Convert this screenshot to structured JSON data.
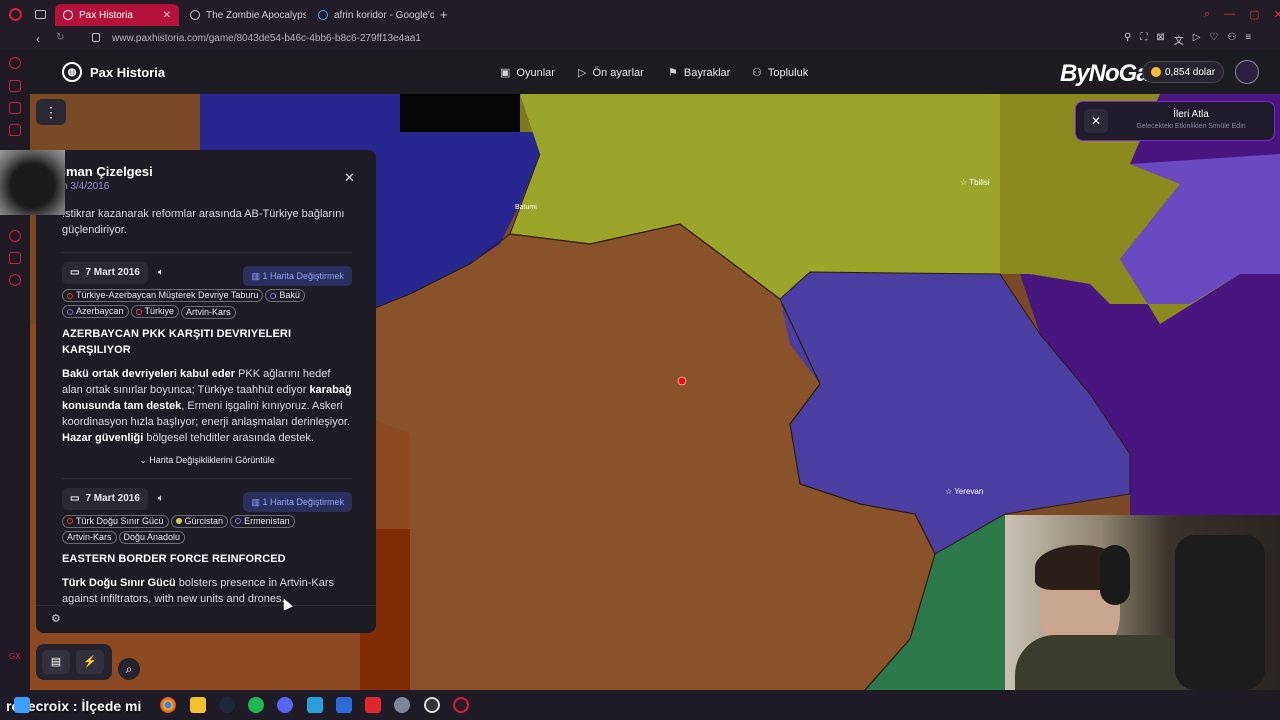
{
  "browser": {
    "tabs": [
      {
        "label": "Pax Historia",
        "active": true
      },
      {
        "label": "The Zombie Apocalypse",
        "active": false
      },
      {
        "label": "afrin koridor - Google'da",
        "active": false
      }
    ],
    "url": "www.paxhistoria.com/game/8043de54-b46c-4bb6-b8c6-279ff13e4aa1"
  },
  "app": {
    "brand": "Pax Historia",
    "nav": [
      {
        "label": "Oyunlar",
        "icon": "gamepad-icon"
      },
      {
        "label": "Ön ayarlar",
        "icon": "play-icon"
      },
      {
        "label": "Bayraklar",
        "icon": "flag-icon"
      },
      {
        "label": "Topluluk",
        "icon": "users-icon"
      }
    ],
    "balance": "0,854 dolar",
    "overlay_logo": "ByNoGame"
  },
  "notification": {
    "title": "İleri Atla",
    "subtitle": "Gelecekteki Etkinlikleri Simüle Edin"
  },
  "timeline": {
    "title": "man Çizelgesi",
    "date_sub": "n 3/4/2016",
    "intro": ".stikrar kazanarak reformlar arasında AB-Türkiye bağlarını güçlendiriyor.",
    "events": [
      {
        "date": "7 Mart 2016",
        "map_change": "1 Harita Değiştirmek",
        "tags": [
          {
            "label": "Türkiye-Azerbaycan Müşterek Devriye Taburu",
            "color": "#e0354f"
          },
          {
            "label": "Bakü",
            "color": "#7c6cf0"
          },
          {
            "label": "Azerbaycan",
            "color": "#7c6cf0"
          },
          {
            "label": "Türkiye",
            "color": "#e0354f"
          },
          {
            "label": "Artvin-Kars",
            "color": ""
          }
        ],
        "headline": "AZERBAYCAN PKK KARŞITI DEVRIYELERI KARŞILIYOR",
        "body_bold1": "Bakü ortak devriyeleri kabul eder",
        "body_text1": " PKK ağlarını hedef alan ortak sınırlar boyunca; Türkiye taahhüt ediyor ",
        "body_bold2": "karabağ konusunda tam destek",
        "body_text2": ", Ermeni işgalini kınıyoruz. Askeri koordinasyon hızla başlıyor; enerji anlaşmaları derinleşiyor. ",
        "body_bold3": "Hazar güvenliği",
        "body_text3": " bölgesel tehditler arasında destek.",
        "show_changes": "Harita Değişikliklerini Görüntüle"
      },
      {
        "date": "7 Mart 2016",
        "map_change": "1 Harita Değiştirmek",
        "tags": [
          {
            "label": "Türk Doğu Sınır Gücü",
            "color": "#e0354f"
          },
          {
            "label": "Gürcistan",
            "color": "#d4cf3a"
          },
          {
            "label": "Ermenistan",
            "color": "#7c6cf0"
          },
          {
            "label": "Artvin-Kars",
            "color": ""
          },
          {
            "label": "Doğu Anadolu",
            "color": ""
          }
        ],
        "headline": "EASTERN BORDER FORCE REINFORCED",
        "body_bold1": "Türk Doğu Sınır Gücü",
        "body_text1": " bolsters presence in Artvin-Kars against infiltrators, with new units and drones."
      }
    ]
  },
  "map_labels": {
    "tbilisi": "Tbilisi",
    "yerevan": "Yerevan",
    "batumi": "Batumi"
  },
  "chat_overlay": "rosecroix : İlçede mi",
  "colors": {
    "turkey": "#8a4a22",
    "georgia": "#9aa52a",
    "armenia": "#4a3ea0",
    "azerbaijan": "#4a1a86",
    "black_sea": "#23238a",
    "accent": "#b4123a"
  }
}
